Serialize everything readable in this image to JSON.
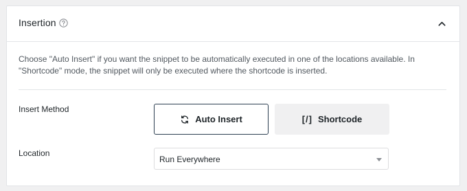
{
  "insertion": {
    "title": "Insertion",
    "description": "Choose \"Auto Insert\" if you want the snippet to be automatically executed in one of the locations available. In \"Shortcode\" mode, the snippet will only be executed where the shortcode is inserted.",
    "insert_method": {
      "label": "Insert Method",
      "options": {
        "auto": "Auto Insert",
        "shortcode": "Shortcode",
        "shortcode_glyph": "[/]"
      },
      "selected": "Auto Insert"
    },
    "location": {
      "label": "Location",
      "selected": "Run Everywhere"
    }
  },
  "colors": {
    "selected_border": "#2c3e50",
    "unselected_bg": "#f0f0f1",
    "panel_bg": "#ffffff",
    "page_bg": "#f0f0f1"
  },
  "icons": {
    "help": "question-circle-icon",
    "collapse": "chevron-up-icon",
    "auto_insert": "sync-arrows-icon",
    "select": "caret-down-icon"
  }
}
